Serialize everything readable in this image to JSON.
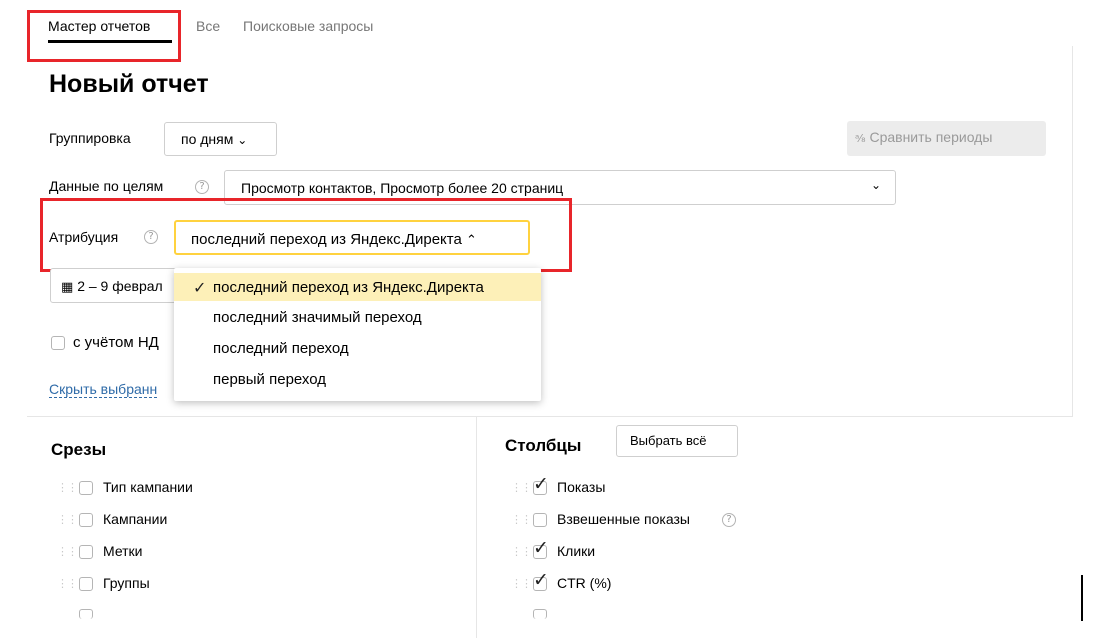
{
  "tabs": {
    "report_wizard": "Мастер отчетов",
    "all": "Все",
    "search_queries": "Поисковые запросы"
  },
  "page_title": "Новый отчет",
  "grouping": {
    "label": "Группировка",
    "value": "по дням"
  },
  "compare_periods": {
    "icon": "compare-icon",
    "label": "Сравнить периоды"
  },
  "goals": {
    "label": "Данные по целям",
    "value": "Просмотр контактов, Просмотр более 20 страниц"
  },
  "attribution": {
    "label": "Атрибуция",
    "value": "последний переход из Яндекс.Директа",
    "options": [
      {
        "label": "последний переход из Яндекс.Директа",
        "selected": true
      },
      {
        "label": "последний значимый переход",
        "selected": false
      },
      {
        "label": "последний переход",
        "selected": false
      },
      {
        "label": "первый переход",
        "selected": false
      }
    ]
  },
  "date_range": {
    "icon": "calendar-icon",
    "value_visible": "2 – 9 феврал"
  },
  "vat": {
    "label_visible": "с учётом НД",
    "checked": false
  },
  "hide_selected_link": "Скрыть выбранн",
  "slices": {
    "title": "Срезы",
    "items": [
      {
        "label": "Тип кампании",
        "checked": false
      },
      {
        "label": "Кампании",
        "checked": false
      },
      {
        "label": "Метки",
        "checked": false
      },
      {
        "label": "Группы",
        "checked": false
      }
    ]
  },
  "columns": {
    "title": "Столбцы",
    "select_all": "Выбрать всё",
    "items": [
      {
        "label": "Показы",
        "checked": true,
        "help": false
      },
      {
        "label": "Взвешенные показы",
        "checked": false,
        "help": true
      },
      {
        "label": "Клики",
        "checked": true,
        "help": false
      },
      {
        "label": "CTR (%)",
        "checked": true,
        "help": false
      }
    ]
  },
  "help_glyph": "?",
  "checkmark_glyph": "✓",
  "colors": {
    "annotation_red": "#e8252a",
    "accent_yellow": "#ffd23f",
    "link_blue": "#2f6ba8"
  }
}
